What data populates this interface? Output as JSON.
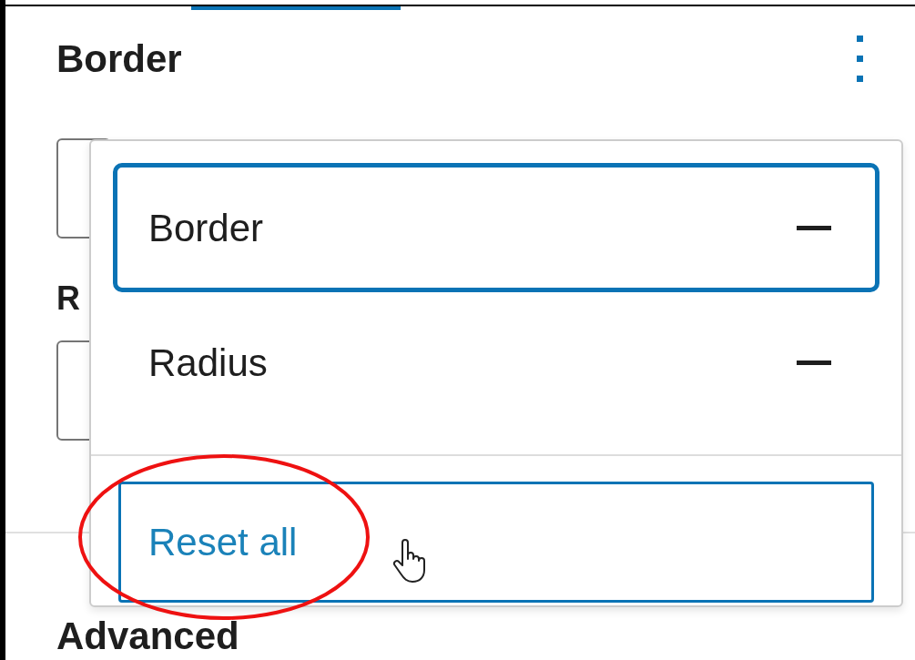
{
  "panel": {
    "title": "Border",
    "radius_label": "R",
    "next_section": "Advanced"
  },
  "menu": {
    "items": [
      {
        "label": "Border",
        "focused": true
      },
      {
        "label": "Radius",
        "focused": false
      }
    ],
    "reset_button": {
      "label": "Reset all"
    }
  }
}
